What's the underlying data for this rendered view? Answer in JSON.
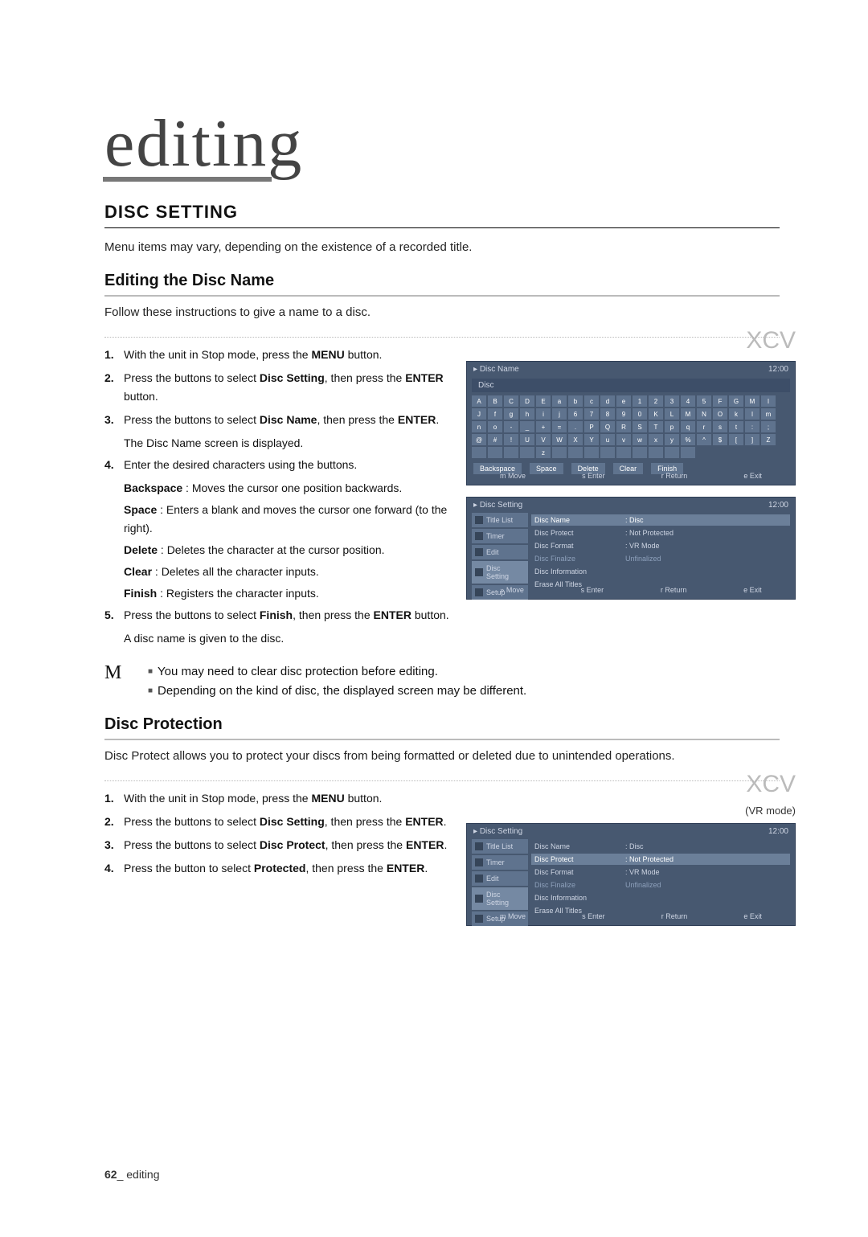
{
  "chapter": "editing",
  "section_title": "DISC SETTING",
  "intro": "Menu items may vary, depending on the existence of a recorded title.",
  "edit_name": {
    "title": "Editing the Disc Name",
    "intro": "Follow these instructions to give a name to a disc.",
    "steps": [
      {
        "pre": "With the unit in Stop mode, press the ",
        "b": "MENU",
        "post": " button."
      },
      {
        "pre": "Press the            buttons to select ",
        "b": "Disc Setting",
        "post": ", then press the ",
        "b2": "ENTER",
        "post2": " button."
      },
      {
        "pre": "Press the            buttons to select ",
        "b": "Disc Name",
        "post": ", then press the ",
        "b2": "ENTER",
        "post2": ".",
        "after": "The Disc Name screen is displayed."
      },
      {
        "pre": "Enter the desired characters using the                    buttons."
      },
      {
        "pre": "Press the                  buttons to select ",
        "b": "Finish",
        "post": ", then press the ",
        "b2": "ENTER",
        "post2": " button.",
        "after": "A disc name is given to the disc."
      }
    ],
    "desc": [
      {
        "b": "Backspace",
        "t": " : Moves the cursor one position backwards."
      },
      {
        "b": "Space",
        "t": " : Enters a blank and moves the cursor one forward (to the right)."
      },
      {
        "b": "Delete",
        "t": " : Deletes the character at the cursor position."
      },
      {
        "b": "Clear",
        "t": " : Deletes all the character inputs."
      },
      {
        "b": "Finish",
        "t": " : Registers the character inputs."
      }
    ],
    "notes": [
      "You may need to clear disc protection before editing.",
      "Depending on the kind of disc, the displayed screen may be different."
    ]
  },
  "discs_label": "XCV",
  "mock_name": {
    "title": "Disc Name",
    "time": "12:00",
    "sub": "Disc",
    "keys_rows": [
      [
        "A",
        "B",
        "C",
        "D",
        "E",
        "a",
        "b",
        "c",
        "d",
        "e",
        "1",
        "2",
        "3",
        "4",
        "5"
      ],
      [
        "F",
        "G",
        "M",
        "I",
        "J",
        "f",
        "g",
        "h",
        "i",
        "j",
        "6",
        "7",
        "8",
        "9",
        "0"
      ],
      [
        "K",
        "L",
        "M",
        "N",
        "O",
        "k",
        "l",
        "m",
        "n",
        "o",
        "-",
        "_",
        "+",
        "=",
        "."
      ],
      [
        "P",
        "Q",
        "R",
        "S",
        "T",
        "p",
        "q",
        "r",
        "s",
        "t",
        ":",
        ";",
        "@",
        "#",
        "!"
      ],
      [
        "U",
        "V",
        "W",
        "X",
        "Y",
        "u",
        "v",
        "w",
        "x",
        "y",
        "%",
        "^",
        "$",
        "[",
        "]"
      ],
      [
        "Z",
        "",
        "",
        "",
        "",
        "z",
        "",
        "",
        "",
        "",
        "",
        "",
        "",
        "",
        ""
      ]
    ],
    "buttons": [
      "Backspace",
      "Space",
      "Delete",
      "Clear",
      "Finish"
    ],
    "foot": [
      "m  Move",
      "s  Enter",
      "r  Return",
      "e  Exit"
    ]
  },
  "mock_setting": {
    "title": "Disc Setting",
    "time": "12:00",
    "side": [
      "Title List",
      "Timer",
      "Edit",
      "Disc Setting",
      "Setup"
    ],
    "selected_row": "name",
    "rows": [
      {
        "id": "name",
        "l": "Disc Name",
        "r": ": Disc"
      },
      {
        "id": "protect",
        "l": "Disc Protect",
        "r": ": Not Protected"
      },
      {
        "id": "format",
        "l": "Disc Format",
        "r": ": VR Mode"
      },
      {
        "id": "finalize",
        "l": "Disc Finalize",
        "r": "Unfinalized",
        "dim": true
      },
      {
        "id": "info",
        "l": "Disc Information",
        "r": ""
      },
      {
        "id": "erase",
        "l": "Erase All Titles",
        "r": ""
      }
    ],
    "foot": [
      "»  Move",
      "s  Enter",
      "r  Return",
      "e  Exit"
    ]
  },
  "protection": {
    "title": "Disc Protection",
    "intro": "Disc Protect allows you to protect your discs from being formatted or deleted due to unintended operations.",
    "sub": "(VR mode)",
    "steps": [
      {
        "pre": "With the unit in Stop mode, press the ",
        "b": "MENU",
        "post": " button."
      },
      {
        "pre": "Press the          buttons to select ",
        "b": "Disc Setting",
        "post": ", then press the ",
        "b2": "ENTER",
        "post2": "."
      },
      {
        "pre": "Press the          buttons to select ",
        "b": "Disc Protect",
        "post": ", then press the ",
        "b2": "ENTER",
        "post2": "."
      },
      {
        "pre": "Press the          button to select ",
        "b": "Protected",
        "post": ", then press the ",
        "b2": "ENTER",
        "post2": "."
      }
    ]
  },
  "mock_protect": {
    "title": "Disc Setting",
    "time": "12:00",
    "side": [
      "Title List",
      "Timer",
      "Edit",
      "Disc Setting",
      "Setup"
    ],
    "selected_row": "protect",
    "rows": [
      {
        "id": "name",
        "l": "Disc Name",
        "r": ": Disc"
      },
      {
        "id": "protect",
        "l": "Disc Protect",
        "r": ": Not Protected"
      },
      {
        "id": "format",
        "l": "Disc Format",
        "r": ": VR Mode"
      },
      {
        "id": "finalize",
        "l": "Disc Finalize",
        "r": "Unfinalized",
        "dim": true
      },
      {
        "id": "info",
        "l": "Disc Information",
        "r": ""
      },
      {
        "id": "erase",
        "l": "Erase All Titles",
        "r": ""
      }
    ],
    "foot": [
      "m  Move",
      "s  Enter",
      "r  Return",
      "e  Exit"
    ]
  },
  "footer": {
    "num": "62",
    "label": "_ editing"
  }
}
